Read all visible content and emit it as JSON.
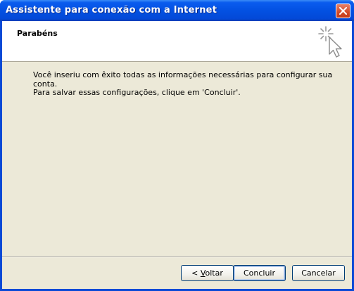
{
  "window": {
    "title": "Assistente para conexão com a Internet",
    "close_label": "Fechar"
  },
  "header": {
    "title": "Parabéns"
  },
  "content": {
    "line1": "Você inseriu com êxito todas as informações necessárias para configurar sua conta.",
    "line2": "Para salvar essas configurações, clique em 'Concluir'."
  },
  "buttons": {
    "back_prefix": "< ",
    "back_mnemonic": "V",
    "back_rest": "oltar",
    "finish": "Concluir",
    "cancel": "Cancelar"
  }
}
